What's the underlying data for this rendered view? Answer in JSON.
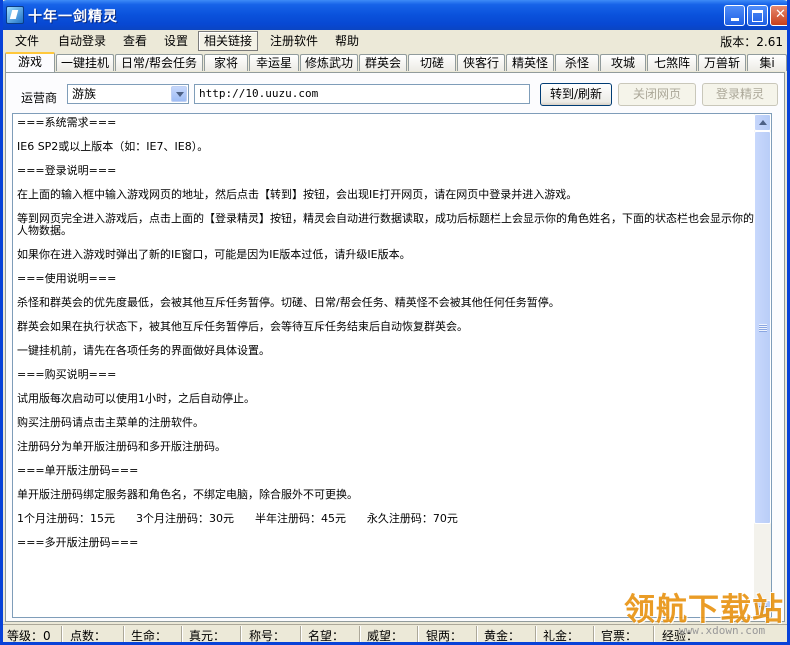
{
  "window": {
    "title": "十年一剑精灵"
  },
  "menu": {
    "items": [
      "文件",
      "自动登录",
      "查看",
      "设置",
      "相关链接",
      "注册软件",
      "帮助"
    ],
    "version": "版本：2.61"
  },
  "tabs": [
    "游戏",
    "一键挂机",
    "日常/帮会任务",
    "家将",
    "幸运星",
    "修炼武功",
    "群英会",
    "切磋",
    "侠客行",
    "精英怪",
    "杀怪",
    "攻城",
    "七煞阵",
    "万兽斩",
    "集i"
  ],
  "toolbar": {
    "operator_label": "运营商",
    "operator_value": "游族",
    "url": "http://10.uuzu.com",
    "go_button": "转到/刷新",
    "close_page_button": "关闭网页",
    "login_button": "登录精灵"
  },
  "content": {
    "paragraphs": [
      "===系统需求===",
      "IE6 SP2或以上版本（如：IE7、IE8）。",
      "",
      "===登录说明===",
      "在上面的输入框中输入游戏网页的地址，然后点击【转到】按钮，会出现IE打开网页，请在网页中登录并进入游戏。",
      "等到网页完全进入游戏后，点击上面的【登录精灵】按钮，精灵会自动进行数据读取，成功后标题栏上会显示你的角色姓名，下面的状态栏也会显示你的人物数据。",
      "如果你在进入游戏时弹出了新的IE窗口，可能是因为IE版本过低，请升级IE版本。",
      "",
      "===使用说明===",
      "杀怪和群英会的优先度最低，会被其他互斥任务暂停。切磋、日常/帮会任务、精英怪不会被其他任何任务暂停。",
      "群英会如果在执行状态下，被其他互斥任务暂停后，会等待互斥任务结束后自动恢复群英会。",
      "一键挂机前，请先在各项任务的界面做好具体设置。",
      "",
      "===购买说明===",
      "试用版每次启动可以使用1小时，之后自动停止。",
      "购买注册码请点击主菜单的注册软件。",
      "注册码分为单开版注册码和多开版注册码。",
      "",
      "===单开版注册码===",
      "单开版注册码绑定服务器和角色名，不绑定电脑，除合服外不可更换。",
      "1个月注册码：15元      3个月注册码：30元      半年注册码：45元      永久注册码：70元",
      "",
      "===多开版注册码==="
    ]
  },
  "status": {
    "level": "等级：0",
    "points": "点数：",
    "hp": "生命：",
    "zhenyuan": "真元：",
    "title": "称号：",
    "fame": "名望：",
    "prestige": "威望：",
    "silver": "银两：",
    "gold": "黄金：",
    "giftgold": "礼金：",
    "official": "官票：",
    "exp": "经验："
  },
  "watermark": {
    "main": "领航下载站",
    "sub": "www.xdown.com"
  }
}
